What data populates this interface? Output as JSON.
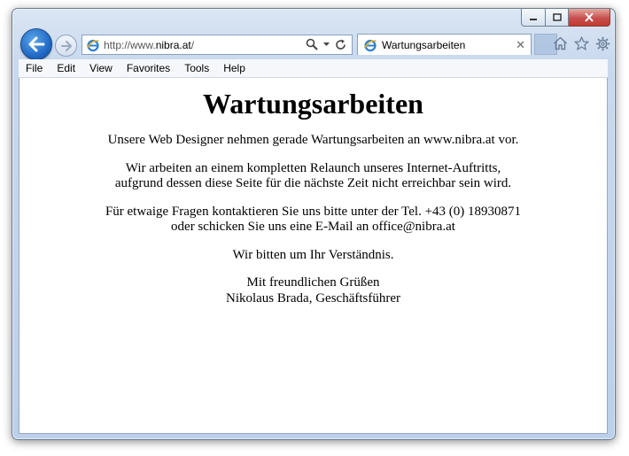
{
  "browser": {
    "address": {
      "prefix": "http://www.",
      "domain": "nibra.at",
      "suffix": "/"
    },
    "tab": {
      "title": "Wartungsarbeiten",
      "close_glyph": "✕"
    },
    "menu": [
      "File",
      "Edit",
      "View",
      "Favorites",
      "Tools",
      "Help"
    ]
  },
  "page": {
    "title": "Wartungsarbeiten",
    "paragraphs": [
      [
        "Unsere Web Designer nehmen gerade Wartungsarbeiten an www.nibra.at vor."
      ],
      [
        "Wir arbeiten an einem kompletten Relaunch unseres Internet-Auftritts,",
        "aufgrund dessen diese Seite für die nächste Zeit nicht erreichbar sein wird."
      ],
      [
        "Für etwaige Fragen kontaktieren Sie uns bitte unter der Tel. +43 (0) 18930871",
        "oder schicken Sie uns eine E-Mail an office@nibra.at"
      ],
      [
        "Wir bitten um Ihr Verständnis."
      ],
      [
        "Mit freundlichen Grüßen",
        "Nikolaus Brada, Geschäftsführer"
      ]
    ]
  },
  "icons": {
    "back": "back-arrow-icon",
    "forward": "forward-arrow-icon",
    "search": "search-icon",
    "refresh": "refresh-icon",
    "home": "home-icon",
    "favorites": "star-icon",
    "settings": "gear-icon"
  },
  "colors": {
    "back_button": "#1e66c2",
    "close_button": "#c75050"
  }
}
